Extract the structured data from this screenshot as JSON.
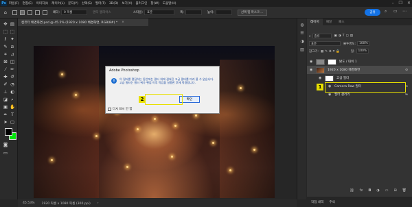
{
  "app": {
    "logo": "Ps",
    "menu": [
      "파일(F)",
      "편집(E)",
      "이미지(I)",
      "레이어(L)",
      "문자(Y)",
      "선택(S)",
      "필터(T)",
      "3D(D)",
      "보기(V)",
      "플러그인",
      "창(W)",
      "도움말(H)"
    ],
    "window_controls": [
      "–",
      "❐",
      "✕"
    ]
  },
  "options": {
    "feather_label": "페더:",
    "feather_value": "0 픽셀",
    "antialias_label": "앤티 앨리어스",
    "style_label": "스타일:",
    "style_value": "표준",
    "width_label": "폭:",
    "height_label": "높이:",
    "select_mask_button": "선택 및 마스크 ...",
    "share_button": "공유"
  },
  "document": {
    "tab_title": "컴퓨터 배경화면.psd @ 45.5% (1920 x 1080 배경화면, RGB/8#) *",
    "tab_close": "×"
  },
  "status": {
    "zoom": "45.53%",
    "info": "1920 픽셀 x 1080 픽셀 (300 ppi)",
    "arrow": "›"
  },
  "dialog": {
    "title": "Adobe Photoshop",
    "info_icon": "i",
    "message": "이 필터를 편집하는 동안에는 필터 위에 겹쳐진 고급 필터를 미리 볼 수 없습니다. 고급 필터는 필터 위가 편집 이후 작업을 실행한 후에 적용됩니다.",
    "ok_button": "확인",
    "dont_show_label": "다시 표시 안 함"
  },
  "annotations": {
    "badge_1": "1",
    "badge_2": "2",
    "color": "#e8e000"
  },
  "layers_panel": {
    "tabs": [
      "레이어",
      "채널",
      "패스"
    ],
    "filter_kind": "종류",
    "blend_mode": "표준",
    "opacity_label": "불투명도:",
    "opacity_value": "100%",
    "lock_label": "잠그기:",
    "fill_label": "칠:",
    "fill_value": "100%",
    "layers": [
      {
        "name": "밝도 / 대비 1"
      },
      {
        "name": "1920 x 1080 배경화면"
      },
      {
        "name": "고급 필터"
      },
      {
        "name": "Camera Raw 필터"
      },
      {
        "name": "필터 갤러리"
      }
    ],
    "footer_tabs": [
      "작업 내역",
      "주석"
    ]
  },
  "colors": {
    "foreground": "#000000",
    "background": "#00e60a",
    "accent": "#1473e6"
  }
}
